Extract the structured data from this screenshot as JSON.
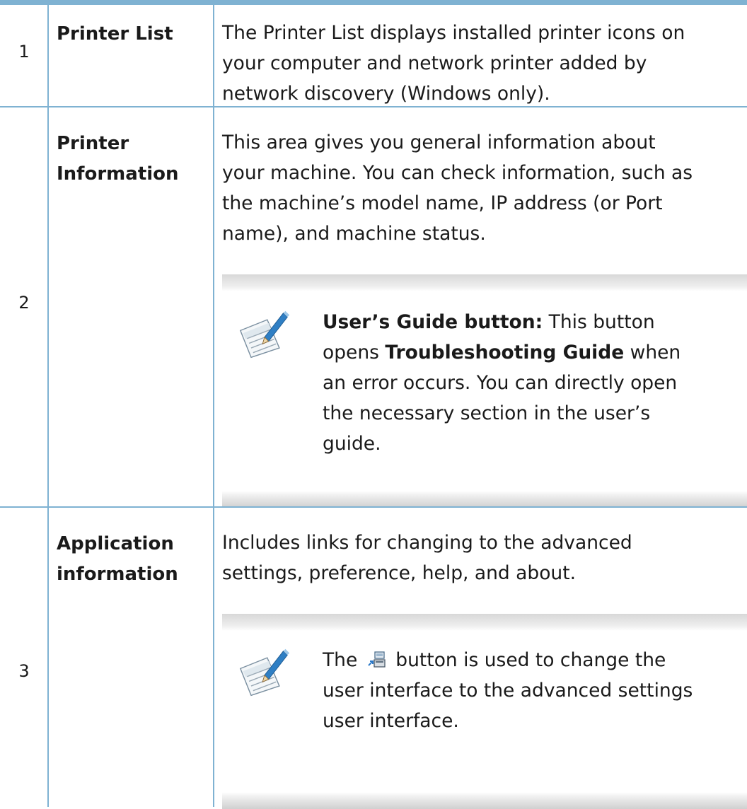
{
  "rows": [
    {
      "number": "1",
      "name_lines": [
        "Printer List"
      ],
      "desc_lines": [
        "The Printer List displays installed printer icons on",
        "your computer and network printer added by",
        "network discovery (Windows only)."
      ]
    },
    {
      "number": "2",
      "name_lines": [
        "Printer",
        "Information"
      ],
      "desc_lines": [
        "This area gives you general information about",
        "your machine. You can check information, such as",
        "the machine’s model name, IP address (or Port",
        "name), and machine status."
      ],
      "note": {
        "icon": "note-pencil-icon",
        "bold_lead": "User’s Guide button:",
        "line1_rest": " This button",
        "line2_pre": "opens ",
        "line2_bold": "Troubleshooting Guide",
        "line2_post": " when",
        "line3": "an error occurs. You can directly open",
        "line4": "the necessary section in the user’s",
        "line5": "guide."
      }
    },
    {
      "number": "3",
      "name_lines": [
        "Application",
        "information"
      ],
      "desc_lines": [
        "Includes links for changing to the advanced",
        "settings, preference, help, and about."
      ],
      "note": {
        "icon": "note-pencil-icon",
        "line1_pre": "The",
        "inline_icon": "switch-ui-icon",
        "line1_post": "button is used to change the",
        "line2": "user interface to the advanced settings",
        "line3": "user interface."
      }
    }
  ],
  "colors": {
    "rule": "#7fb2d2",
    "note_bar": "#d8d8d8"
  }
}
